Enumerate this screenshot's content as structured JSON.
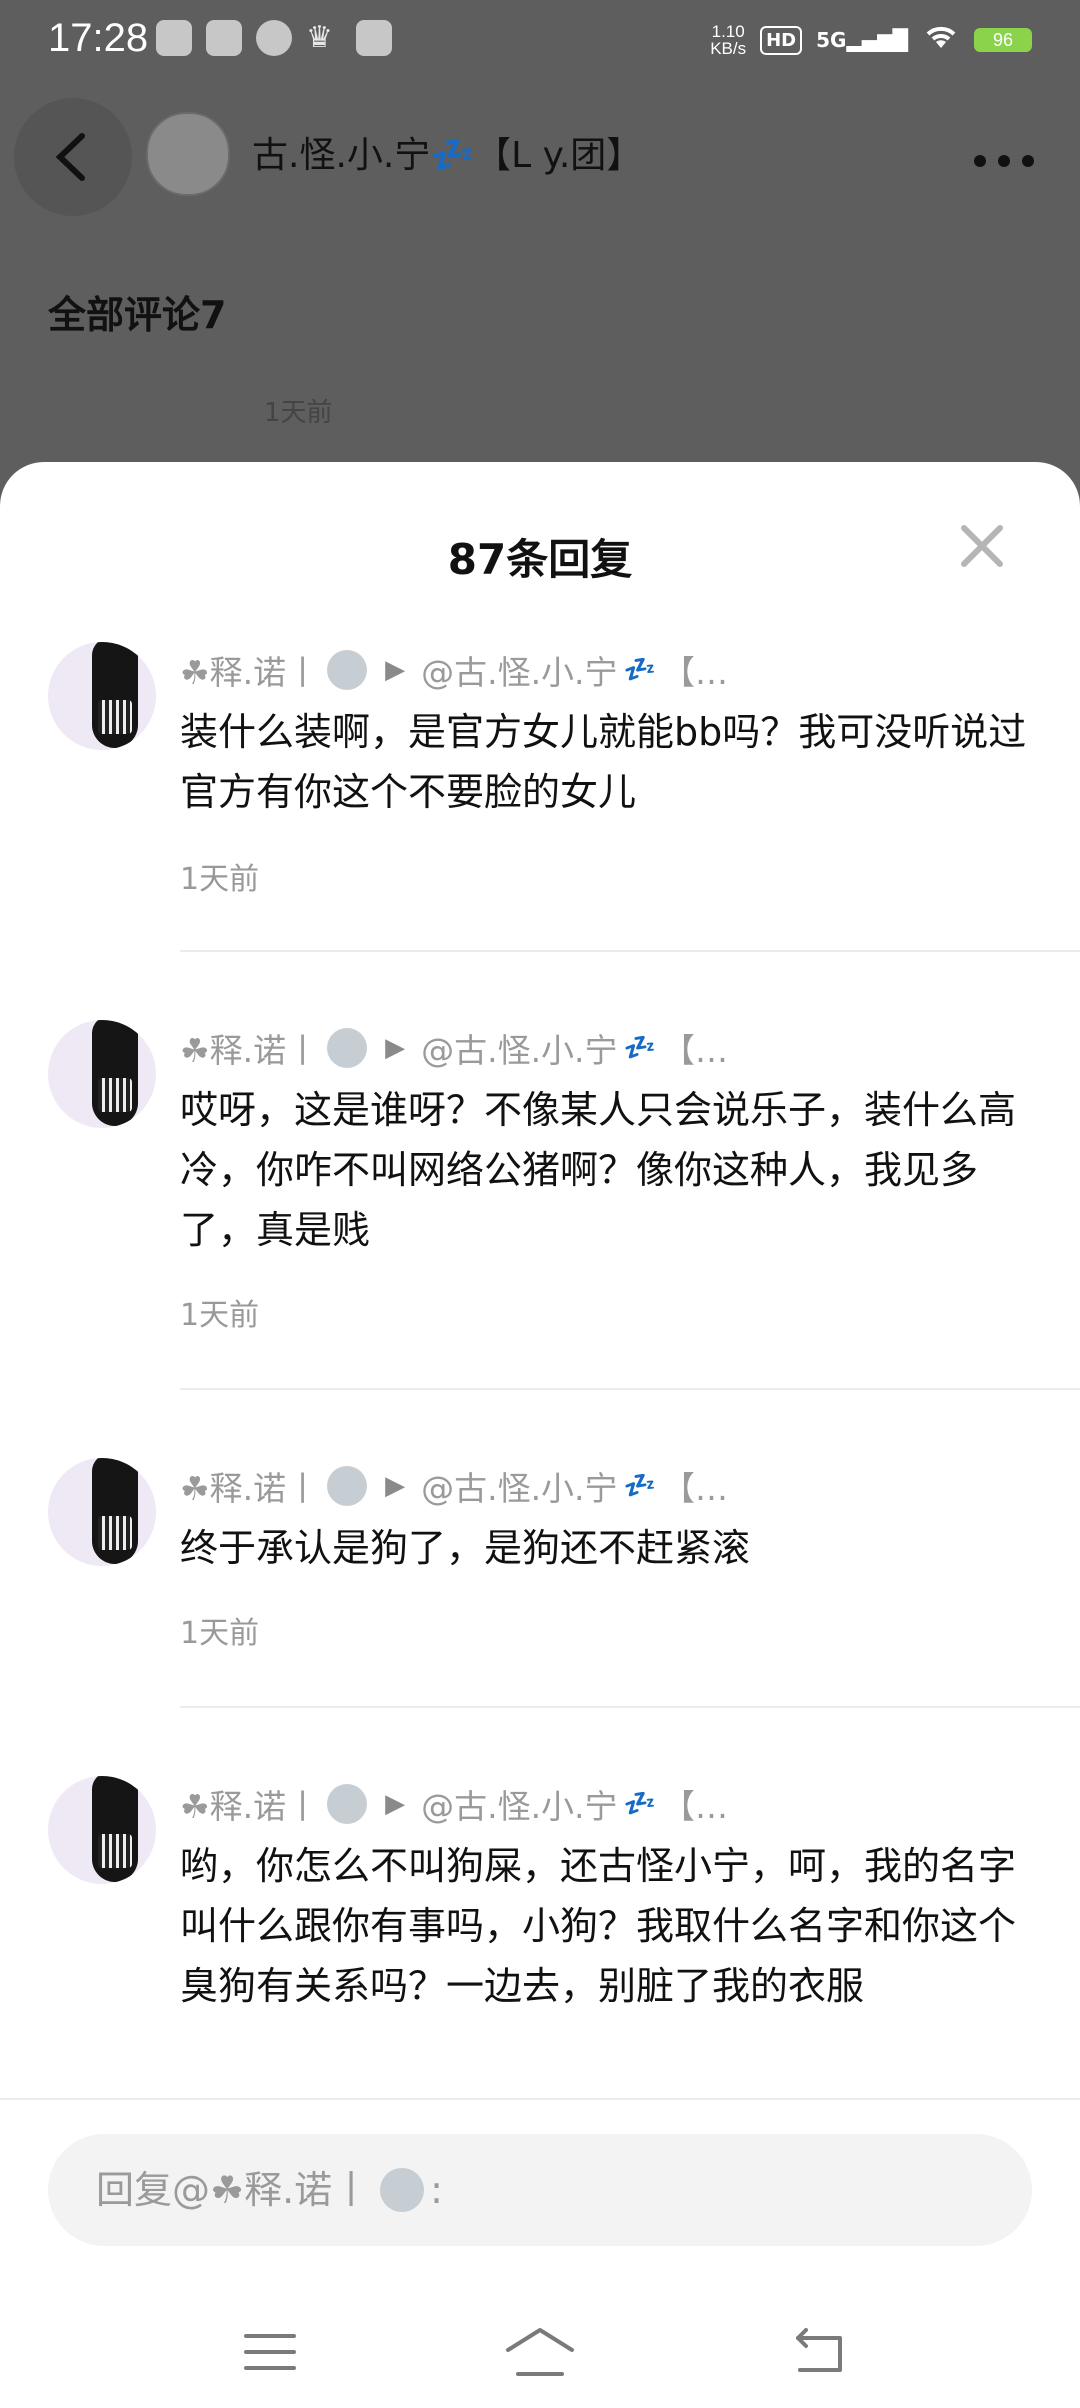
{
  "status_bar": {
    "time": "17:28",
    "net_speed_value": "1.10",
    "net_speed_unit": "KB/s",
    "hd": "HD",
    "network": "5G",
    "battery": "96"
  },
  "background_page": {
    "header_title": "古.怪.小.宁💤【L y.团】",
    "section_title": "全部评论7",
    "comment_time": "1天前"
  },
  "sheet": {
    "title": "87条回复",
    "replies": [
      {
        "user": "☘释.诺丨",
        "target": "@古.怪.小.宁",
        "zzz": "💤",
        "tail": "【…",
        "text": "装什么装啊，是官方女儿就能bb吗？我可没听说过官方有你这个不要脸的女儿",
        "time": "1天前"
      },
      {
        "user": "☘释.诺丨",
        "target": "@古.怪.小.宁",
        "zzz": "💤",
        "tail": "【…",
        "text": "哎呀，这是谁呀？不像某人只会说乐子，装什么高冷，你咋不叫网络公猪啊？像你这种人，我见多了，真是贱",
        "time": "1天前"
      },
      {
        "user": "☘释.诺丨",
        "target": "@古.怪.小.宁",
        "zzz": "💤",
        "tail": "【…",
        "text": "终于承认是狗了，是狗还不赶紧滚",
        "time": "1天前"
      },
      {
        "user": "☘释.诺丨",
        "target": "@古.怪.小.宁",
        "zzz": "💤",
        "tail": "【…",
        "text": "哟，你怎么不叫狗屎，还古怪小宁，呵，我的名字叫什么跟你有事吗，小狗？我取什么名字和你这个臭狗有关系吗？一边去，别脏了我的衣服",
        "time": ""
      }
    ]
  },
  "input": {
    "placeholder_prefix": "回复@☘释.诺丨",
    "placeholder_suffix": ":"
  },
  "icons": {
    "back": "back-arrow-icon",
    "more": "more-dots-icon",
    "close": "close-icon",
    "nav_menu": "menu-icon",
    "nav_home": "home-icon",
    "nav_back": "nav-back-icon"
  },
  "colors": {
    "overlay": "#5e5e5e",
    "sheet": "#ffffff",
    "meta_text": "#9a9a9a",
    "battery": "#8ad34a"
  }
}
